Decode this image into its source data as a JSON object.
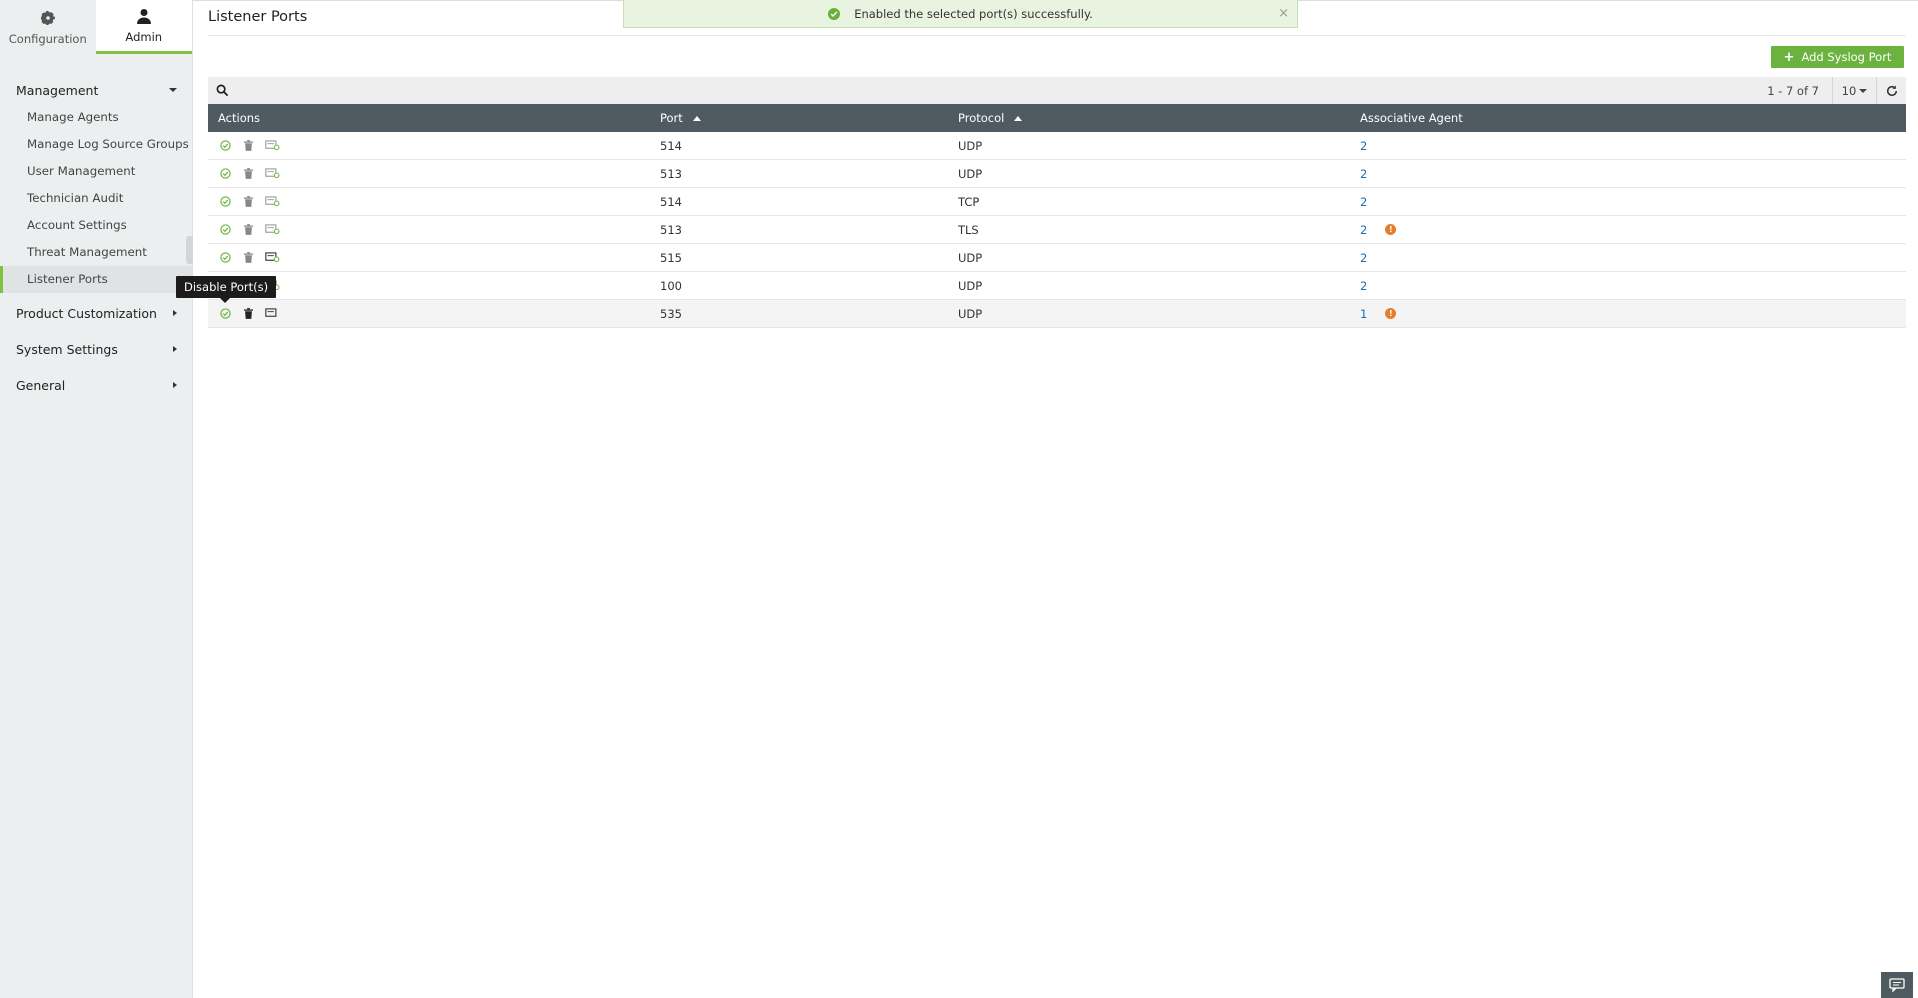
{
  "sidebar": {
    "tabs": [
      {
        "label": "Configuration",
        "icon": "gear-icon"
      },
      {
        "label": "Admin",
        "icon": "user-icon"
      }
    ],
    "management": {
      "label": "Management",
      "items": [
        "Manage Agents",
        "Manage Log Source Groups",
        "User Management",
        "Technician Audit",
        "Account Settings",
        "Threat Management",
        "Listener Ports"
      ]
    },
    "groups": [
      "Product Customization",
      "System Settings",
      "General"
    ]
  },
  "header": {
    "title": "Listener Ports",
    "toast": "Enabled the selected port(s) successfully.",
    "toast_close": "×",
    "add_button": "Add Syslog Port",
    "add_plus": "+"
  },
  "toolbar": {
    "count": "1 - 7 of 7",
    "page_size": "10"
  },
  "table": {
    "columns": {
      "actions": "Actions",
      "port": "Port",
      "protocol": "Protocol",
      "agent": "Associative Agent"
    },
    "rows": [
      {
        "port": "514",
        "protocol": "UDP",
        "agent": "2"
      },
      {
        "port": "513",
        "protocol": "UDP",
        "agent": "2"
      },
      {
        "port": "514",
        "protocol": "TCP",
        "agent": "2"
      },
      {
        "port": "513",
        "protocol": "TLS",
        "agent": "2"
      },
      {
        "port": "515",
        "protocol": "UDP",
        "agent": "2"
      },
      {
        "port": "100",
        "protocol": "UDP",
        "agent": "2"
      },
      {
        "port": "535",
        "protocol": "UDP",
        "agent": "1"
      }
    ]
  },
  "tooltip": "Disable Port(s)",
  "colors": {
    "accent": "#7fc242",
    "header": "#505b61",
    "link": "#1a6fb3",
    "warning": "#e57d2a"
  }
}
